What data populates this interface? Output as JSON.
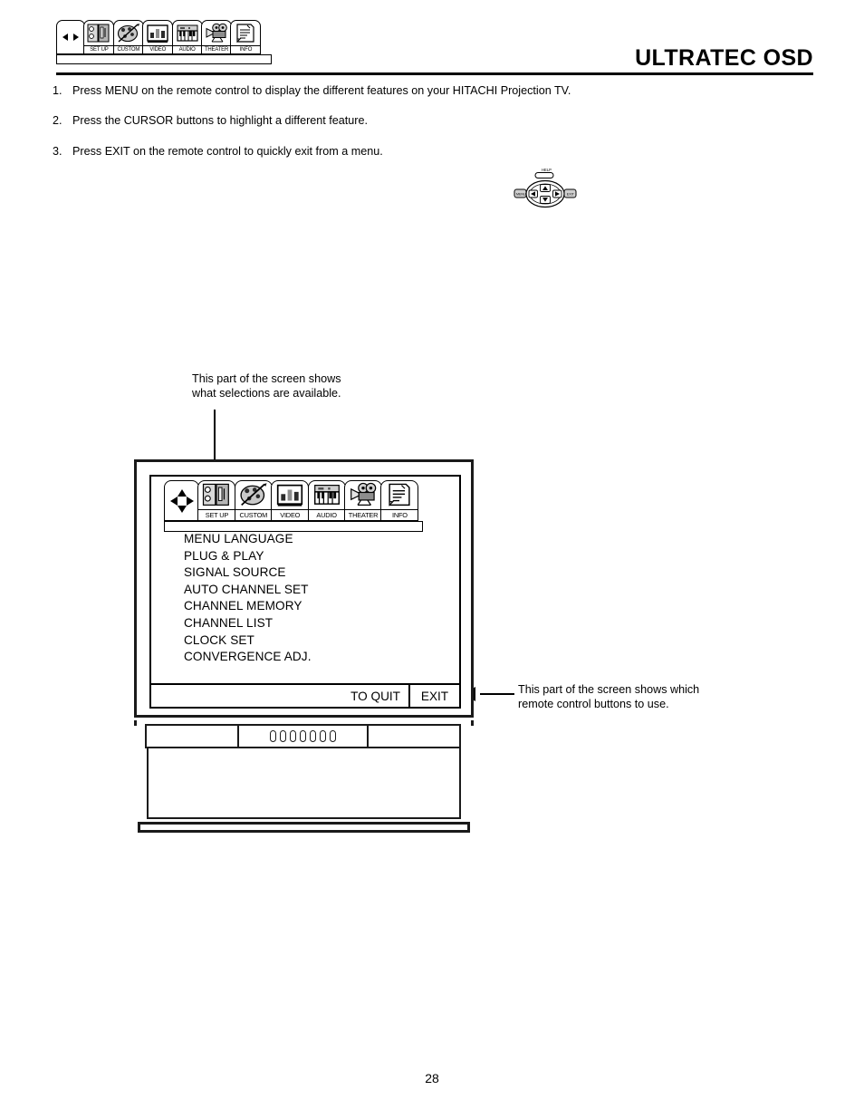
{
  "header": {
    "title": "ULTRATEC OSD",
    "nav_tabs": [
      {
        "label": "",
        "icon": "left-right-arrows-icon"
      },
      {
        "label": "SET UP",
        "icon": "setup-icon"
      },
      {
        "label": "CUSTOM",
        "icon": "custom-palette-icon"
      },
      {
        "label": "VIDEO",
        "icon": "video-monitor-icon"
      },
      {
        "label": "AUDIO",
        "icon": "audio-keyboard-icon"
      },
      {
        "label": "THEATER",
        "icon": "theater-projector-icon"
      },
      {
        "label": "INFO",
        "icon": "info-document-icon"
      }
    ]
  },
  "steps": [
    {
      "num": "1.",
      "text": "Press MENU on the remote control to display the different features on your HITACHI Projection TV."
    },
    {
      "num": "2.",
      "text": "Press the CURSOR buttons to highlight a different feature."
    },
    {
      "num": "3.",
      "text": "Press EXIT on the remote control to quickly exit from a menu."
    }
  ],
  "remote": {
    "help_label": "HELP",
    "menu_label": "MENU",
    "exit_label": "EXIT",
    "cursor_up": "up-arrow-icon",
    "cursor_down": "down-arrow-icon",
    "cursor_left": "left-arrow-icon",
    "cursor_right": "right-arrow-icon"
  },
  "callouts": {
    "top": "This part of the screen shows\nwhat selections are available.",
    "top_line1": "This part of the screen shows",
    "top_line2": "what selections are available.",
    "right_line1": "This part of the screen shows which",
    "right_line2": "remote control buttons to use."
  },
  "tv": {
    "osd_tabs": [
      {
        "label": "",
        "icon": "four-way-cursor-icon"
      },
      {
        "label": "SET UP",
        "icon": "setup-icon"
      },
      {
        "label": "CUSTOM",
        "icon": "custom-palette-icon"
      },
      {
        "label": "VIDEO",
        "icon": "video-monitor-icon"
      },
      {
        "label": "AUDIO",
        "icon": "audio-keyboard-icon"
      },
      {
        "label": "THEATER",
        "icon": "theater-projector-icon"
      },
      {
        "label": "INFO",
        "icon": "info-document-icon"
      }
    ],
    "menu_items": [
      "MENU LANGUAGE",
      "PLUG & PLAY",
      "SIGNAL SOURCE",
      "AUTO CHANNEL SET",
      "CHANNEL MEMORY",
      "CHANNEL LIST",
      "CLOCK SET",
      "CONVERGENCE ADJ."
    ],
    "footer": {
      "to_quit_label": "TO QUIT",
      "exit_label": "EXIT"
    },
    "cabinet_button_count": 7
  },
  "footer": {
    "page_number": "28"
  },
  "colors": {
    "ink": "#000000",
    "outline": "#1a1a1a",
    "page_bg": "#ffffff",
    "icon_gray_light": "#d6d6d6",
    "icon_gray_mid": "#9a9a9a",
    "icon_gray_dark": "#4a4a4a"
  }
}
